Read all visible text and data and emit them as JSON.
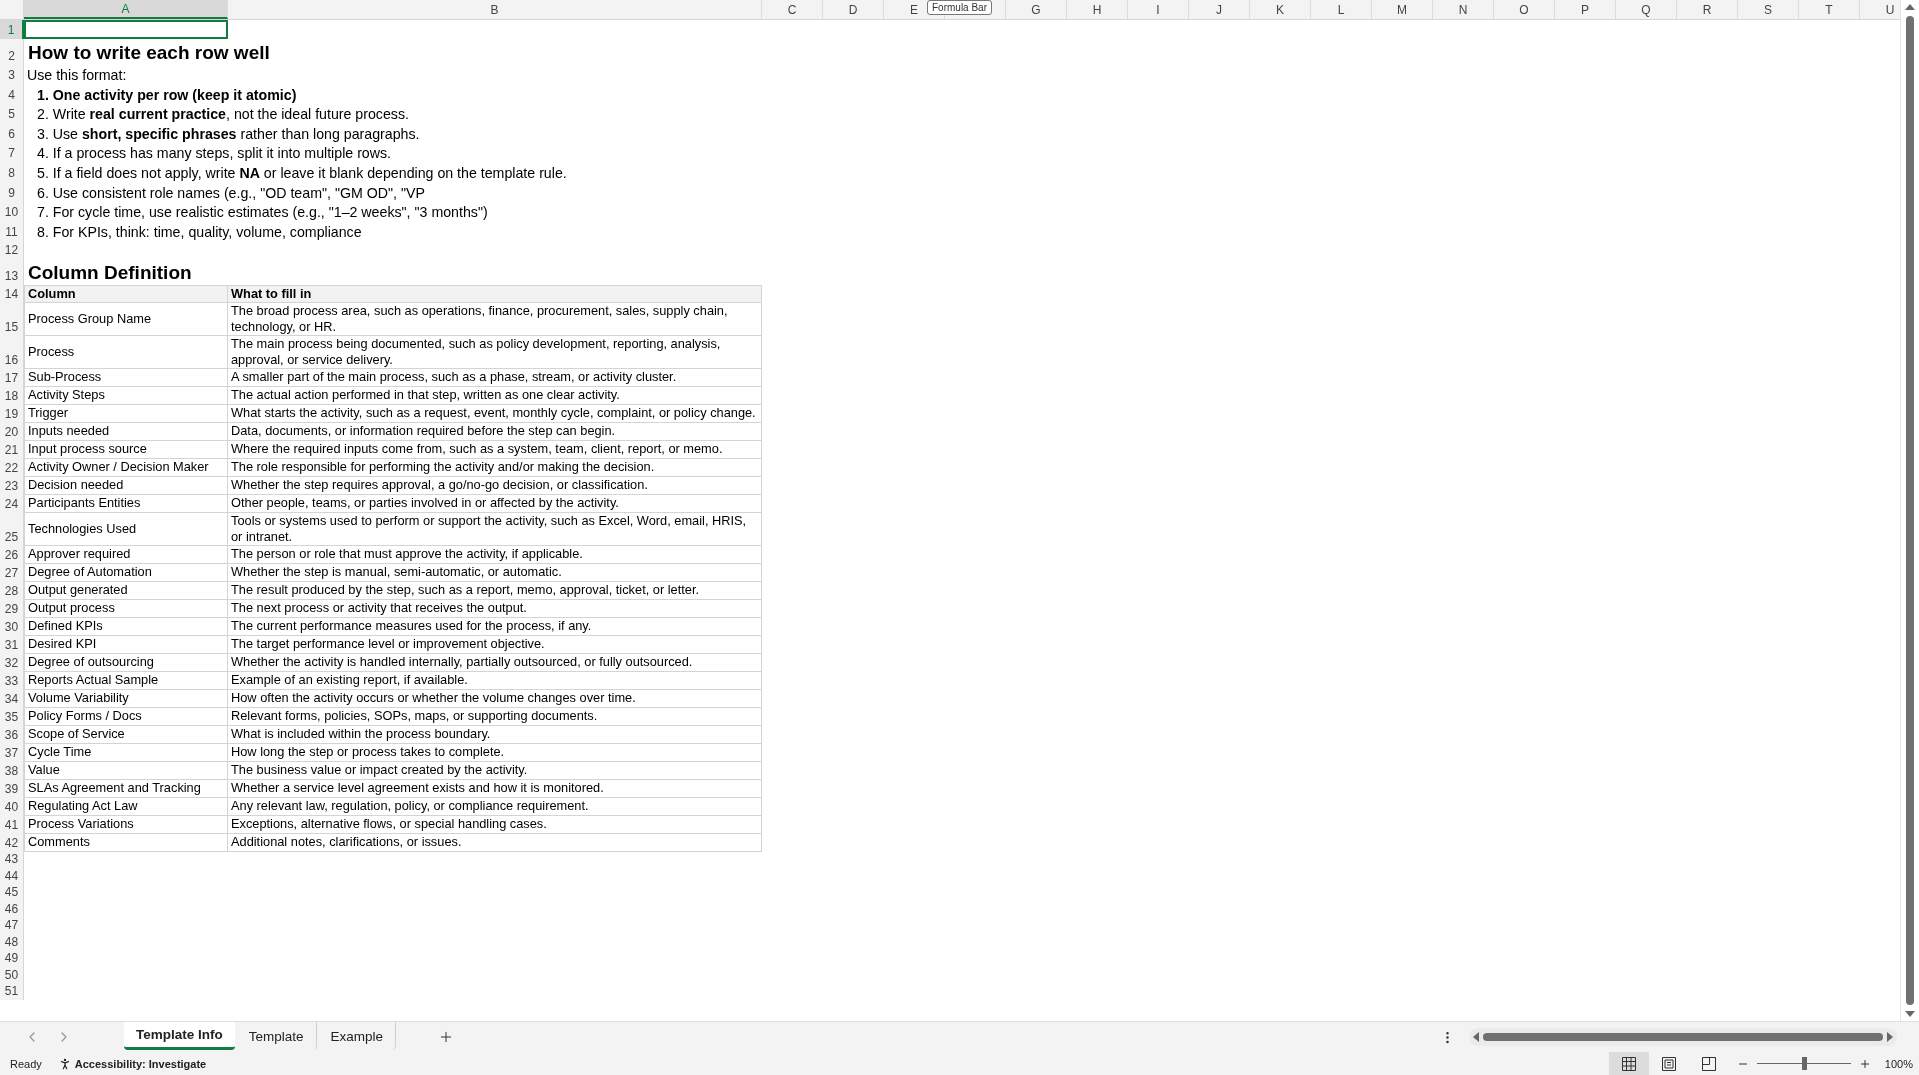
{
  "formula_bar_tooltip": "Formula Bar",
  "columns": [
    {
      "label": "A",
      "selected": true
    },
    {
      "label": "B",
      "selected": false
    },
    {
      "label": "C",
      "selected": false
    },
    {
      "label": "D",
      "selected": false
    },
    {
      "label": "E",
      "selected": false
    },
    {
      "selected": false
    },
    {
      "label": "G",
      "selected": false
    },
    {
      "label": "H",
      "selected": false
    },
    {
      "label": "I",
      "selected": false
    },
    {
      "label": "J",
      "selected": false
    },
    {
      "label": "K",
      "selected": false
    },
    {
      "label": "L",
      "selected": false
    },
    {
      "label": "M",
      "selected": false
    },
    {
      "label": "N",
      "selected": false
    },
    {
      "label": "O",
      "selected": false
    },
    {
      "label": "P",
      "selected": false
    },
    {
      "label": "Q",
      "selected": false
    },
    {
      "label": "R",
      "selected": false
    },
    {
      "label": "S",
      "selected": false
    },
    {
      "label": "T",
      "selected": false
    },
    {
      "label": "U",
      "selected": false
    }
  ],
  "row_numbers": [
    {
      "label": "1",
      "selected": true
    },
    {
      "label": "2",
      "selected": false
    },
    {
      "label": "3",
      "selected": false
    },
    {
      "label": "4",
      "selected": false
    },
    {
      "label": "5",
      "selected": false
    },
    {
      "label": "6",
      "selected": false
    },
    {
      "label": "7",
      "selected": false
    },
    {
      "label": "8",
      "selected": false
    },
    {
      "label": "9",
      "selected": false
    },
    {
      "label": "10",
      "selected": false
    },
    {
      "label": "11",
      "selected": false
    },
    {
      "label": "12",
      "selected": false
    },
    {
      "label": "13",
      "selected": false
    },
    {
      "label": "14",
      "selected": false
    },
    {
      "label": "15",
      "selected": false
    },
    {
      "label": "16",
      "selected": false
    },
    {
      "label": "17",
      "selected": false
    },
    {
      "label": "18",
      "selected": false
    },
    {
      "label": "19",
      "selected": false
    },
    {
      "label": "20",
      "selected": false
    },
    {
      "label": "21",
      "selected": false
    },
    {
      "label": "22",
      "selected": false
    },
    {
      "label": "23",
      "selected": false
    },
    {
      "label": "24",
      "selected": false
    },
    {
      "label": "25",
      "selected": false
    },
    {
      "label": "26",
      "selected": false
    },
    {
      "label": "27",
      "selected": false
    },
    {
      "label": "28",
      "selected": false
    },
    {
      "label": "29",
      "selected": false
    },
    {
      "label": "30",
      "selected": false
    },
    {
      "label": "31",
      "selected": false
    },
    {
      "label": "32",
      "selected": false
    },
    {
      "label": "33",
      "selected": false
    },
    {
      "label": "34",
      "selected": false
    },
    {
      "label": "35",
      "selected": false
    },
    {
      "label": "36",
      "selected": false
    },
    {
      "label": "37",
      "selected": false
    },
    {
      "label": "38",
      "selected": false
    },
    {
      "label": "39",
      "selected": false
    },
    {
      "label": "40",
      "selected": false
    },
    {
      "label": "41",
      "selected": false
    },
    {
      "label": "42",
      "selected": false
    },
    {
      "label": "43",
      "selected": false
    },
    {
      "label": "44",
      "selected": false
    },
    {
      "label": "45",
      "selected": false
    },
    {
      "label": "46",
      "selected": false
    },
    {
      "label": "47",
      "selected": false
    },
    {
      "label": "48",
      "selected": false
    },
    {
      "label": "49",
      "selected": false
    },
    {
      "label": "50",
      "selected": false
    },
    {
      "label": "51",
      "selected": false
    }
  ],
  "heading": "How to write each row well",
  "intro": "Use this format:",
  "instructions": [
    {
      "text": "1. One activity per row (keep it atomic)",
      "bold": true
    },
    {
      "text": "2. Write **real current practice**, not the ideal future process.",
      "bold": false
    },
    {
      "text": "3. Use **short, specific phrases** rather than long paragraphs.",
      "bold": false
    },
    {
      "text": "4. If a process has many steps, split it into multiple rows.",
      "bold": false
    },
    {
      "text": "5. If a field does not apply, write **NA** or leave it blank depending on the template rule.",
      "bold": false
    },
    {
      "text": "6. Use consistent role names (e.g., \"OD team\", \"GM OD\", \"VP",
      "bold": false
    },
    {
      "text": "7. For cycle time, use realistic estimates (e.g., \"1–2 weeks\", \"3 months\")",
      "bold": false
    },
    {
      "text": "8. For KPIs, think: time, quality, volume, compliance",
      "bold": false
    }
  ],
  "section_title": "Column Definition",
  "table": {
    "columns": [
      "Column",
      "What to fill in"
    ],
    "rows": [
      [
        "Process Group Name",
        "The broad process area, such as operations, finance, procurement, sales, supply chain, technology, or HR."
      ],
      [
        "Process",
        "The main process being documented, such as policy development, reporting, analysis, approval, or service delivery."
      ],
      [
        "Sub-Process",
        "A smaller part of the main process, such as a phase, stream, or activity cluster."
      ],
      [
        "Activity Steps",
        "The actual action performed in that step, written as one clear activity."
      ],
      [
        "Trigger",
        "What starts the activity, such as a request, event, monthly cycle, complaint, or policy change."
      ],
      [
        "Inputs needed",
        "Data, documents, or information required before the step can begin."
      ],
      [
        "Input process source",
        "Where the required inputs come from, such as a system, team, client, report, or memo."
      ],
      [
        "Activity Owner / Decision Maker",
        "The role responsible for performing the activity and/or making the decision."
      ],
      [
        "Decision needed",
        "Whether the step requires approval, a go/no-go decision, or classification."
      ],
      [
        "Participants Entities",
        "Other people, teams, or parties involved in or affected by the activity."
      ],
      [
        "Technologies Used",
        "Tools or systems used to perform or support the activity, such as Excel, Word, email, HRIS, or intranet."
      ],
      [
        "Approver required",
        "The person or role that must approve the activity, if applicable."
      ],
      [
        "Degree of Automation",
        "Whether the step is manual, semi-automatic, or automatic."
      ],
      [
        "Output generated",
        "The result produced by the step, such as a report, memo, approval, ticket, or letter."
      ],
      [
        "Output process",
        "The next process or activity that receives the output."
      ],
      [
        "Defined KPIs",
        "The current performance measures used for the process, if any."
      ],
      [
        "Desired KPI",
        "The target performance level or improvement objective."
      ],
      [
        "Degree of outsourcing",
        "Whether the activity is handled internally, partially outsourced, or fully outsourced."
      ],
      [
        "Reports Actual Sample",
        "Example of an existing report, if available."
      ],
      [
        "Volume Variability",
        "How often the activity occurs or whether the volume changes over time."
      ],
      [
        "Policy Forms / Docs",
        "Relevant forms, policies, SOPs, maps, or supporting documents."
      ],
      [
        "Scope of Service",
        "What is included within the process boundary."
      ],
      [
        "Cycle Time",
        "How long the step or process takes to complete."
      ],
      [
        "Value",
        "The business value or impact created by the activity."
      ],
      [
        "SLAs Agreement and Tracking",
        "Whether a service level agreement exists and how it is monitored."
      ],
      [
        "Regulating Act Law",
        "Any relevant law, regulation, policy, or compliance requirement."
      ],
      [
        "Process Variations",
        "Exceptions, alternative flows, or special handling cases."
      ],
      [
        "Comments",
        "Additional notes, clarifications, or issues."
      ]
    ]
  },
  "sheet_tabs": [
    {
      "label": "Template Info",
      "selected": true
    },
    {
      "label": "Template",
      "selected": false
    },
    {
      "label": "Example",
      "selected": false
    }
  ],
  "status_bar": {
    "status": "Ready",
    "accessibility": "Accessibility: Investigate",
    "views": [
      {
        "kind": "normal",
        "selected": true
      },
      {
        "kind": "page-layout",
        "selected": false
      },
      {
        "kind": "page-break",
        "selected": false
      }
    ],
    "zoom": {
      "level": 0.5,
      "reading": "100%"
    }
  }
}
